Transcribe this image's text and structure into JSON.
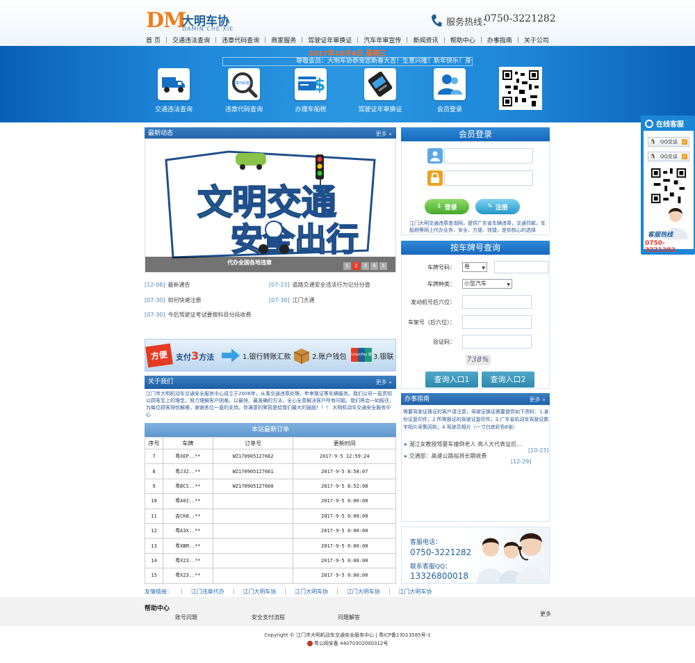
{
  "header": {
    "logo_mark": "DM",
    "logo_name": "大明车协",
    "logo_pinyin": "DAMIN CHE XIE",
    "hotline_label": "服务热线：",
    "hotline_number": "0750-3221282"
  },
  "nav": [
    "首 页",
    "交通违法查询",
    "违章代码查询",
    "商家服务",
    "驾驶证年审换证",
    "汽车年审宣传",
    "新闻资讯",
    "帮助中心",
    "办事指南",
    "关于公司"
  ],
  "banner": {
    "date": "2017年10月4日  星期三",
    "marquee": "尊敬会员：大明车协恭贺您新春大吉！生意兴隆！新年快乐！身体健",
    "services": [
      "交通违法查询",
      "违章代码查询",
      "办理车船税",
      "驾驶证年审换证",
      "会员登录"
    ],
    "code_icon_text": "违章代码查询"
  },
  "news": {
    "title": "最新动态",
    "more": "更多",
    "slide_text_1": "文明交通",
    "slide_text_2": "安全出行",
    "slide_caption": "代办全国各地违章",
    "dots": [
      "1",
      "2",
      "3",
      "4",
      "5"
    ],
    "items": [
      {
        "date": "[12-08]",
        "title": "最新通告"
      },
      {
        "date": "[07-23]",
        "title": "道路交通安全违法行为记分分值"
      },
      {
        "date": "[07-30]",
        "title": "如何快速注册"
      },
      {
        "date": "[07-30]",
        "title": "江门大通"
      },
      {
        "date": "[07-30]",
        "title": "今后驾驶证考试要按科目分段收费"
      }
    ]
  },
  "pay": {
    "badge": "方便",
    "title_a": "支付",
    "title_num": "3",
    "title_b": "方法",
    "m1": "1.银行转账汇款",
    "m2": "2.账户钱包",
    "m3": "3.银联",
    "unionpay": "UnionPay 银联"
  },
  "about": {
    "title": "关于我们",
    "more": "更多",
    "text": "江门市大明机动车交通安全服务中心成立于2006年，从事交通违章处理，年审换证等车辆服务。我们公司一直贯彻以顾客至上的理念，努力理解客户困难，以最快，最准确的方法，全心全意解决客户所有问题。我们将会一如既往，为每位顾客排忧解难，谢谢各位一直的支持。你满意的笑容是给我们最大的鼓励！！！ 大明机动车交通安全服务中心"
  },
  "orders": {
    "title": "本站最新订单",
    "headers": [
      "序号",
      "车牌",
      "订单号",
      "更新时间"
    ],
    "rows": [
      [
        "7",
        "粤XEP..**",
        "WZ170905127662",
        "2017-9-5 12:59:24"
      ],
      [
        "8",
        "粤J32..**",
        "WZ170905127661",
        "2017-9-5 8:58:07"
      ],
      [
        "9",
        "粤BCS..**",
        "WZ170905127660",
        "2017-9-5 8:52:08"
      ],
      [
        "10",
        "粤A02..**",
        "",
        "2017-9-5 0:00:00"
      ],
      [
        "11",
        "吉CK8..**",
        "",
        "2017-9-5 0:00:00"
      ],
      [
        "12",
        "粤A3X..**",
        "",
        "2017-9-5 0:00:00"
      ],
      [
        "13",
        "粤XBM..**",
        "",
        "2017-9-5 0:00:00"
      ],
      [
        "14",
        "粤X23..**",
        "",
        "2017-9-5 0:00:00"
      ],
      [
        "15",
        "粤X23..**",
        "",
        "2017-9-5 0:00:00"
      ]
    ]
  },
  "login": {
    "title": "会员登录",
    "login_btn": "登录",
    "register_btn": "注册",
    "desc": "江门大明交通违章查询网，提供广东省车辆违章，交通罚款，车船税等网上代办业务，安全、方便、快捷，是你核心的选择"
  },
  "plate_query": {
    "title": "按车牌号查询",
    "plate_label": "车牌号码：",
    "plate_prefix": "粤",
    "type_label": "车牌种类：",
    "type_value": "小型汽车",
    "engine_label": "发动机号后六位：",
    "vin_label": "车架号（后六位）：",
    "captcha_label": "验证码：",
    "captcha_value": "738%",
    "btn1": "查询入口1",
    "btn2": "查询入口2"
  },
  "guide": {
    "title": "办事指南",
    "more": "更多",
    "text": "需要驾驶证换证的客户请注意，驾驶证换证需要提供如下资料：1.身份证复印件；2.所需换证的驾驶证复印件；3.广东省机动车驾驶证数字相片采集回执；4.驾驶员相片（一寸白底彩色6张）",
    "items": [
      {
        "title": "溜江女教授驾豪车撞倒老人 亮人大代表证后...",
        "date": "[10-23]"
      },
      {
        "title": "交通部：高速公路拟将长期收费",
        "date": "[12-29]"
      }
    ]
  },
  "customer_service": {
    "phone_label": "客服电话：",
    "phone": "0750-3221282",
    "qq_label": "联系客服QQ：",
    "qq": "13326800018"
  },
  "friend_links": {
    "label": "友情链接：",
    "links": [
      "江门违章代办",
      "江门大明车协",
      "江门大明车协",
      "江门大明车协",
      "江门大明车协"
    ]
  },
  "help": {
    "title": "帮助中心",
    "items": [
      "账号问题",
      "安全支付流程",
      "问题解答"
    ],
    "more": "更多"
  },
  "footer": {
    "line1": "Copyright © 江门市大明机动车交通安全服务中心 | 粤ICP备13013585号-1",
    "line2": "粤公网安备 44070302000312号"
  },
  "float_cs": {
    "title": "在线客服",
    "qq1": "QQ交谈",
    "qq2": "QQ交谈",
    "hotline_label": "客服热线",
    "hotline": "0750-3221282"
  },
  "colors": {
    "brand_orange": "#ee7d1a",
    "brand_blue": "#1f5f9a",
    "banner_blue": "#1d86d8",
    "panel_blue": "#1a5ea6",
    "link_blue": "#2a5590"
  }
}
